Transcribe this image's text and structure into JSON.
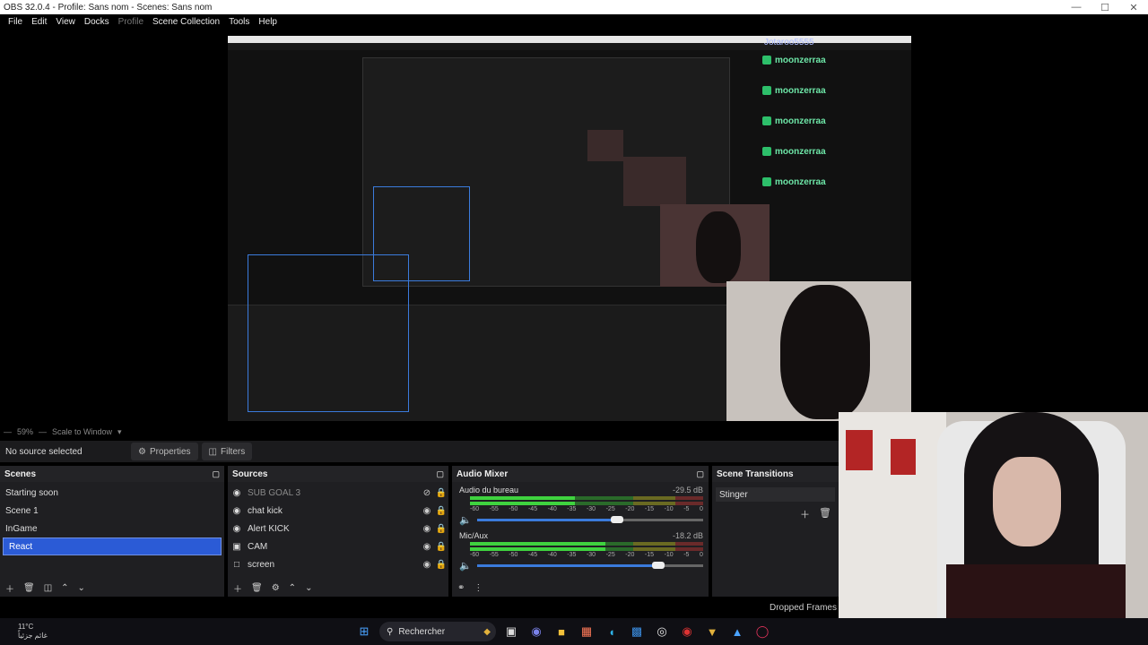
{
  "window": {
    "title": "OBS 32.0.4 - Profile: Sans nom - Scenes: Sans nom",
    "min": "—",
    "max": "☐",
    "close": "✕"
  },
  "menu": [
    "File",
    "Edit",
    "View",
    "Docks",
    "Profile",
    "Scene Collection",
    "Tools",
    "Help"
  ],
  "preview": {
    "chat_header": "Jotaroo5555",
    "chat_users": [
      "moonzerraa",
      "moonzerraa",
      "moonzerraa",
      "moonzerraa",
      "moonzerraa"
    ]
  },
  "preview_controls": {
    "zoom": "59%",
    "scale_mode": "Scale to Window"
  },
  "context_bar": {
    "no_source": "No source selected",
    "properties": "Properties",
    "filters": "Filters"
  },
  "scenes": {
    "title": "Scenes",
    "items": [
      {
        "label": "Starting soon",
        "selected": false
      },
      {
        "label": "Scene 1",
        "selected": false
      },
      {
        "label": "InGame",
        "selected": false
      },
      {
        "label": "React",
        "selected": true
      }
    ]
  },
  "sources": {
    "title": "Sources",
    "items": [
      {
        "label": "SUB GOAL 3",
        "dim": true
      },
      {
        "label": "chat kick",
        "dim": false
      },
      {
        "label": "Alert KICK",
        "dim": false
      },
      {
        "label": "CAM",
        "dim": false
      },
      {
        "label": "screen",
        "dim": false
      }
    ]
  },
  "mixer": {
    "title": "Audio Mixer",
    "ticks": [
      "-60",
      "-55",
      "-50",
      "-45",
      "-40",
      "-35",
      "-30",
      "-25",
      "-20",
      "-15",
      "-10",
      "-5",
      "0"
    ],
    "channels": [
      {
        "name": "Audio du bureau",
        "db": "-29.5 dB",
        "level": 0.45,
        "volume": 0.62
      },
      {
        "name": "Mic/Aux",
        "db": "-18.2 dB",
        "level": 0.58,
        "volume": 0.8
      }
    ]
  },
  "transitions": {
    "title": "Scene Transitions",
    "current": "Stinger"
  },
  "status": {
    "dropped_frames": "Dropped Frames"
  },
  "taskbar": {
    "temperature": "11°C",
    "weather_text": "غائم جزئياً",
    "search_placeholder": "Rechercher"
  }
}
